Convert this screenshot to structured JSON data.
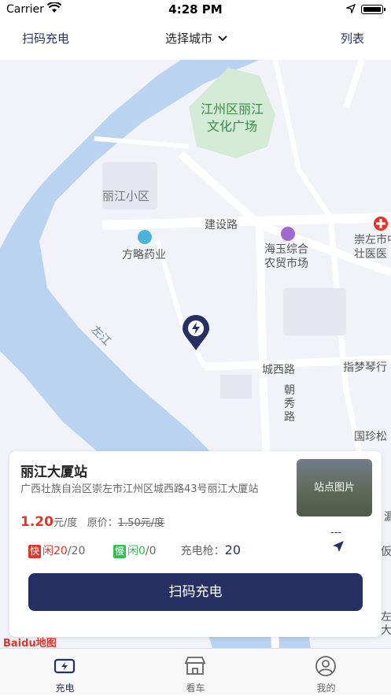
{
  "status_bar": {
    "carrier": "Carrier",
    "time": "4:28 PM"
  },
  "navbar": {
    "scan_label": "扫码充电",
    "city_label": "选择城市",
    "list_label": "列表"
  },
  "map": {
    "labels": {
      "park": "江州区丽江\n文化广场",
      "community": "丽江小区",
      "road_jianshe": "建设路",
      "pharmacy": "方略药业",
      "market": "海玉综合\n农贸市场",
      "hospital": "崇左市中\n壮医医",
      "river": "左江",
      "road_chengxi": "城西路",
      "road_chaoxiu": "朝\n秀\n路",
      "zhimeng": "指梦琴行",
      "guozhen": "国珍松",
      "edge1": "漏",
      "edge2": "仮",
      "edge3": "左\n大"
    },
    "logo": "Baidu地图"
  },
  "station": {
    "name": "丽江大厦站",
    "address": "广西壮族自治区崇左市江州区城西路43号丽江大厦站",
    "price": "1.20",
    "price_unit": "元/度",
    "orig_label": "原价：",
    "orig_price": "1.50元/度",
    "photo_label": "站点图片",
    "fast_tag": "快",
    "fast_idle_label": "闲",
    "fast_free": "20",
    "fast_total": "/20",
    "slow_tag": "慢",
    "slow_idle_label": "闲",
    "slow_free": "0",
    "slow_total": "/0",
    "gun_label": "充电枪：",
    "gun_count": "20",
    "distance": "---",
    "scan_button": "扫码充电"
  },
  "tabs": [
    {
      "label": "充电",
      "icon": "charging-icon",
      "active": true
    },
    {
      "label": "看车",
      "icon": "store-icon",
      "active": false
    },
    {
      "label": "我的",
      "icon": "user-icon",
      "active": false
    }
  ],
  "colors": {
    "brand": "#273063",
    "price": "#e43328",
    "slow": "#2bc24d",
    "water": "#b9d3f0",
    "park": "#d3ead5"
  }
}
